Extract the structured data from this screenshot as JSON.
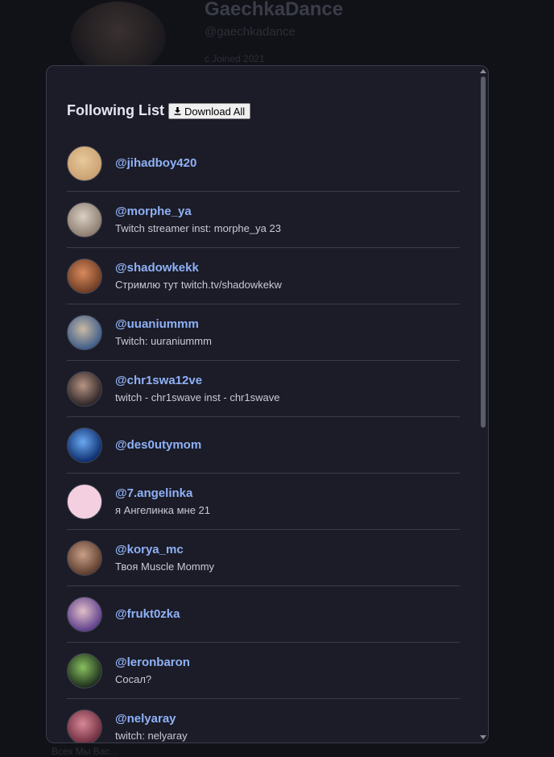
{
  "background": {
    "name": "GaechkaDance",
    "handle": "@gaechkadance",
    "joined": "с Joined 2021",
    "footer": "Всех Мы Вас..."
  },
  "modal": {
    "title": "Following List",
    "download_label": "Download All",
    "icons": {
      "download": "download-icon"
    }
  },
  "following": [
    {
      "handle": "@jihadboy420",
      "bio": "",
      "avatar_color": "#c8a070",
      "avatar_color2": "#e8c89a"
    },
    {
      "handle": "@morphe_ya",
      "bio": "Twitch streamer inst: morphe_ya 23",
      "avatar_color": "#8a7a6c",
      "avatar_color2": "#d9cfc4"
    },
    {
      "handle": "@shadowkekk",
      "bio": "Стримлю тут twitch.tv/shadowkekw",
      "avatar_color": "#6a3a24",
      "avatar_color2": "#d98a5c"
    },
    {
      "handle": "@uuaniummm",
      "bio": "Twitch: uuraniummm",
      "avatar_color": "#3a5a88",
      "avatar_color2": "#c9b9a4"
    },
    {
      "handle": "@chr1swa12ve",
      "bio": "twitch - chr1swave inst - chr1swave",
      "avatar_color": "#2a2224",
      "avatar_color2": "#b89484"
    },
    {
      "handle": "@des0utymom",
      "bio": "",
      "avatar_color": "#0a2a6a",
      "avatar_color2": "#6aa8f0"
    },
    {
      "handle": "@7.angelinka",
      "bio": "я Ангелинка мне 21",
      "avatar_color": "#f3cfe0",
      "avatar_color2": "#f3cfe0"
    },
    {
      "handle": "@korya_mc",
      "bio": "Твоя Muscle Mommy",
      "avatar_color": "#5a3a2a",
      "avatar_color2": "#c9a088"
    },
    {
      "handle": "@frukt0zka",
      "bio": "",
      "avatar_color": "#5a3a8a",
      "avatar_color2": "#e0c0c8"
    },
    {
      "handle": "@leronbaron",
      "bio": "Сосал?",
      "avatar_color": "#1a2a1a",
      "avatar_color2": "#88c060"
    },
    {
      "handle": "@nelyaray",
      "bio": "twitch: nelyaray",
      "avatar_color": "#6a2a3a",
      "avatar_color2": "#d88898"
    }
  ]
}
